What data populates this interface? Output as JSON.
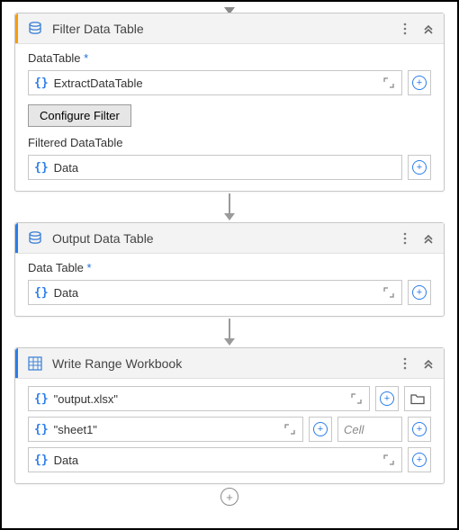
{
  "activities": {
    "filter": {
      "title": "Filter Data Table",
      "accent": "#f59e0b",
      "fields": {
        "datatable_label": "DataTable",
        "datatable_required": "*",
        "datatable_value": "ExtractDataTable",
        "configure_btn": "Configure Filter",
        "filtered_label": "Filtered DataTable",
        "filtered_value": "Data"
      }
    },
    "output": {
      "title": "Output Data Table",
      "accent": "#2b7de9",
      "fields": {
        "datatable_label": "Data Table",
        "datatable_required": "*",
        "datatable_value": "Data"
      }
    },
    "write": {
      "title": "Write Range Workbook",
      "accent": "#2b7de9",
      "fields": {
        "workbook_value": "\"output.xlsx\"",
        "sheet_value": "\"sheet1\"",
        "cell_placeholder": "Cell",
        "range_value": "Data"
      }
    }
  },
  "icons": {
    "kebab": "⋮",
    "collapse": "︽",
    "plus": "+",
    "expand": "⤢"
  }
}
